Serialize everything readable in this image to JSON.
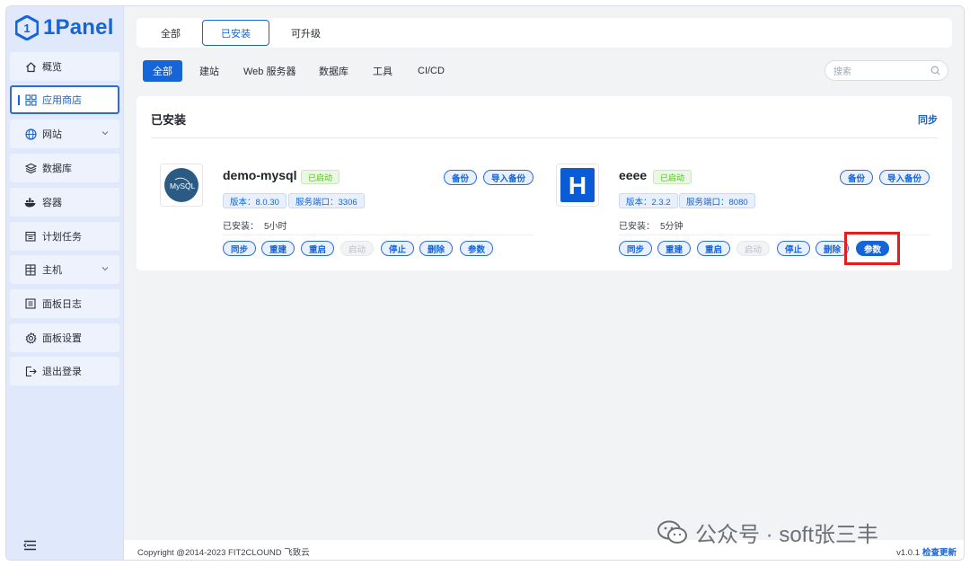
{
  "brand": {
    "logo_text": "1Panel",
    "accent": "#1565d8"
  },
  "sidebar": {
    "items": [
      {
        "label": "概览",
        "icon": "home-icon"
      },
      {
        "label": "应用商店",
        "icon": "app-grid-icon",
        "active": true
      },
      {
        "label": "网站",
        "icon": "globe-icon",
        "expandable": true
      },
      {
        "label": "数据库",
        "icon": "layers-icon"
      },
      {
        "label": "容器",
        "icon": "docker-icon"
      },
      {
        "label": "计划任务",
        "icon": "calendar-icon"
      },
      {
        "label": "主机",
        "icon": "host-icon",
        "expandable": true
      },
      {
        "label": "面板日志",
        "icon": "log-icon"
      },
      {
        "label": "面板设置",
        "icon": "gear-icon"
      },
      {
        "label": "退出登录",
        "icon": "logout-icon"
      }
    ]
  },
  "top_tabs": [
    {
      "label": "全部"
    },
    {
      "label": "已安装",
      "active": true
    },
    {
      "label": "可升级"
    }
  ],
  "filters": [
    {
      "label": "全部",
      "active": true
    },
    {
      "label": "建站"
    },
    {
      "label": "Web 服务器"
    },
    {
      "label": "数据库"
    },
    {
      "label": "工具"
    },
    {
      "label": "CI/CD"
    }
  ],
  "search": {
    "placeholder": "搜索"
  },
  "panel": {
    "title": "已安装",
    "sync_label": "同步"
  },
  "apps": [
    {
      "name": "demo-mysql",
      "status": "已启动",
      "version": "版本：8.0.30",
      "port": "服务端口：3306",
      "installed_label": "已安装：",
      "installed_time": "5小时",
      "top_actions": [
        "备份",
        "导入备份"
      ],
      "actions": [
        "同步",
        "重建",
        "重启",
        "启动",
        "停止",
        "删除",
        "参数"
      ],
      "icon_text": "MySQL"
    },
    {
      "name": "eeee",
      "status": "已启动",
      "version": "版本：2.3.2",
      "port": "服务端口：8080",
      "installed_label": "已安装：",
      "installed_time": "5分钟",
      "top_actions": [
        "备份",
        "导入备份"
      ],
      "actions": [
        "同步",
        "重建",
        "重启",
        "启动",
        "停止",
        "删除",
        "参数"
      ],
      "icon_text": "H"
    }
  ],
  "footer": {
    "copyright": "Copyright @2014-2023 FIT2CLOUND 飞致云",
    "version": "v1.0.1",
    "update_label": "检查更新"
  },
  "watermark": {
    "text": "公众号 · soft张三丰"
  }
}
